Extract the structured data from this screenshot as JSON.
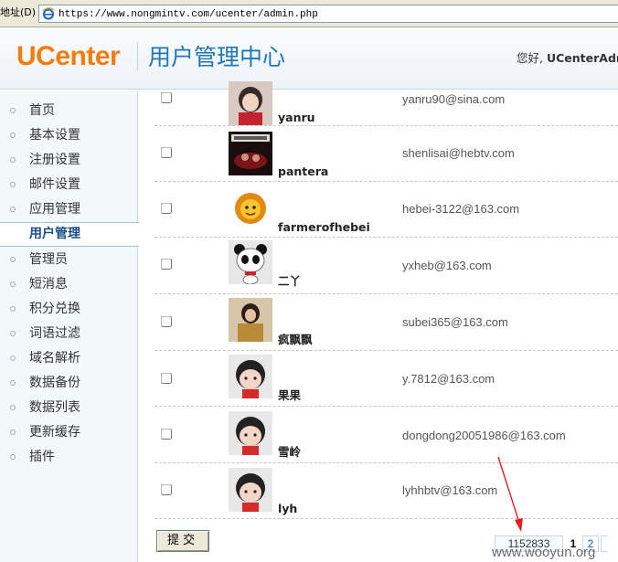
{
  "browser": {
    "address_label": "地址(D)",
    "url": "https://www.nongmintv.com/ucenter/admin.php"
  },
  "header": {
    "logo": "UCenter",
    "app_title": "用户管理中心",
    "greeting_prefix": "您好, ",
    "greeting_user": "UCenterAdm"
  },
  "sidebar": {
    "items": [
      {
        "label": "首页",
        "active": false
      },
      {
        "label": "基本设置",
        "active": false
      },
      {
        "label": "注册设置",
        "active": false
      },
      {
        "label": "邮件设置",
        "active": false
      },
      {
        "label": "应用管理",
        "active": false
      },
      {
        "label": "用户管理",
        "active": true
      },
      {
        "label": "管理员",
        "active": false
      },
      {
        "label": "短消息",
        "active": false
      },
      {
        "label": "积分兑换",
        "active": false
      },
      {
        "label": "词语过滤",
        "active": false
      },
      {
        "label": "域名解析",
        "active": false
      },
      {
        "label": "数据备份",
        "active": false
      },
      {
        "label": "数据列表",
        "active": false
      },
      {
        "label": "更新缓存",
        "active": false
      },
      {
        "label": "插件",
        "active": false
      }
    ]
  },
  "users": [
    {
      "username": "yanru",
      "email": "yanru90@sina.com",
      "avatar": "photo-portrait-icon"
    },
    {
      "username": "pantera",
      "email": "shenlisai@hebtv.com",
      "avatar": "band-photo-icon"
    },
    {
      "username": "farmerofhebei",
      "email": "hebei-3122@163.com",
      "avatar": "cartoon-lion-icon"
    },
    {
      "username": "二丫",
      "email": "yxheb@163.com",
      "avatar": "cartoon-panda-icon"
    },
    {
      "username": "疯飘飘",
      "email": "subei365@163.com",
      "avatar": "photo-portrait-icon"
    },
    {
      "username": "果果",
      "email": "y.7812@163.com",
      "avatar": "default-avatar-icon"
    },
    {
      "username": "雪岭",
      "email": "dongdong20051986@163.com",
      "avatar": "default-avatar-icon"
    },
    {
      "username": "lyh",
      "email": "lyhhbtv@163.com",
      "avatar": "default-avatar-icon"
    }
  ],
  "actions": {
    "submit_label": "提交"
  },
  "pager": {
    "total": "1152833",
    "current_page": "1",
    "next_page": "2"
  },
  "watermark": "www.wooyun.org",
  "colors": {
    "logo": "#f37c0f",
    "title": "#1d79b5",
    "annotation_arrow": "#e02020"
  }
}
